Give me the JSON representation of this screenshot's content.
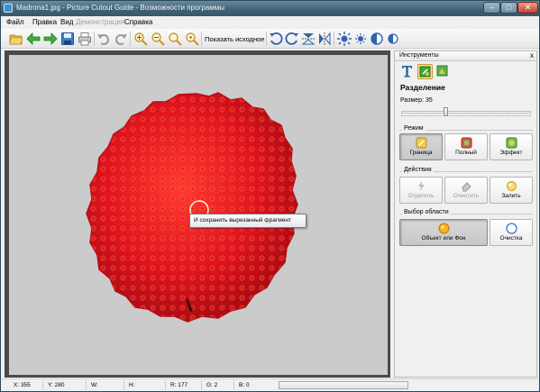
{
  "window": {
    "title": "Madrona1.jpg - Picture Cutout Guide - Возможности программы",
    "minimize_glyph": "–",
    "maximize_glyph": "□",
    "close_glyph": "✕"
  },
  "menu": {
    "items": [
      {
        "label": "Файл",
        "enabled": true
      },
      {
        "label": "Правка",
        "enabled": true
      },
      {
        "label": "Вид",
        "enabled": true
      },
      {
        "label": "Демонстрация",
        "enabled": false
      },
      {
        "label": "Справка",
        "enabled": true
      }
    ]
  },
  "toolbar": {
    "show_original_label": "Показать исходное",
    "icons": [
      "open-folder-icon",
      "back-arrow-icon",
      "forward-arrow-icon",
      "save-disk-icon",
      "print-icon",
      "undo-icon",
      "redo-icon",
      "zoom-in-icon",
      "zoom-out-icon",
      "zoom-fit-icon",
      "zoom-actual-icon",
      "rotate-left-icon",
      "rotate-right-icon",
      "flip-vertical-icon",
      "flip-horizontal-icon",
      "brightness-icon",
      "contrast-sun-icon",
      "levels-icon",
      "invert-icon"
    ]
  },
  "canvas": {
    "tooltip": "И сохранить вырезанный фрагмент",
    "background_color": "#cbcbcb",
    "subject_color": "#e0141e"
  },
  "tools_panel": {
    "header": "Инструменты",
    "close_glyph": "x",
    "mode_icons": [
      "text-tool-icon",
      "cutout-tool-icon",
      "effects-tool-icon"
    ],
    "section_title": "Разделение",
    "size_label": "Размер: 35",
    "size_value": 35,
    "size_fraction": 0.34,
    "mode_group": {
      "label": "Режим",
      "buttons": [
        {
          "label": "Граница",
          "icon": "border-brush-icon",
          "active": true
        },
        {
          "label": "Полный",
          "icon": "full-fill-icon",
          "active": false
        },
        {
          "label": "Эффект",
          "icon": "effect-icon",
          "active": false
        }
      ]
    },
    "actions_group": {
      "label": "Действия",
      "buttons": [
        {
          "label": "Отделить",
          "icon": "separate-icon",
          "enabled": false
        },
        {
          "label": "Очистить",
          "icon": "eraser-icon",
          "enabled": false
        },
        {
          "label": "Залить",
          "icon": "fill-bucket-icon",
          "enabled": true
        }
      ]
    },
    "selection_group": {
      "label": "Выбор области",
      "buttons": [
        {
          "label": "Объект или Фон",
          "icon": "object-circle-icon",
          "active": true
        },
        {
          "label": "Очистка",
          "icon": "clear-circle-icon",
          "active": false
        }
      ]
    }
  },
  "status": {
    "x": "X: 355",
    "y": "Y: 280",
    "w": "W:",
    "h": "H:",
    "r": "R: 177",
    "g": "G: 2",
    "b": "B: 0",
    "progress_fraction": 0.0
  },
  "colors": {
    "accent_selected": "#fbe39a",
    "titlebar": "#3e6174"
  }
}
